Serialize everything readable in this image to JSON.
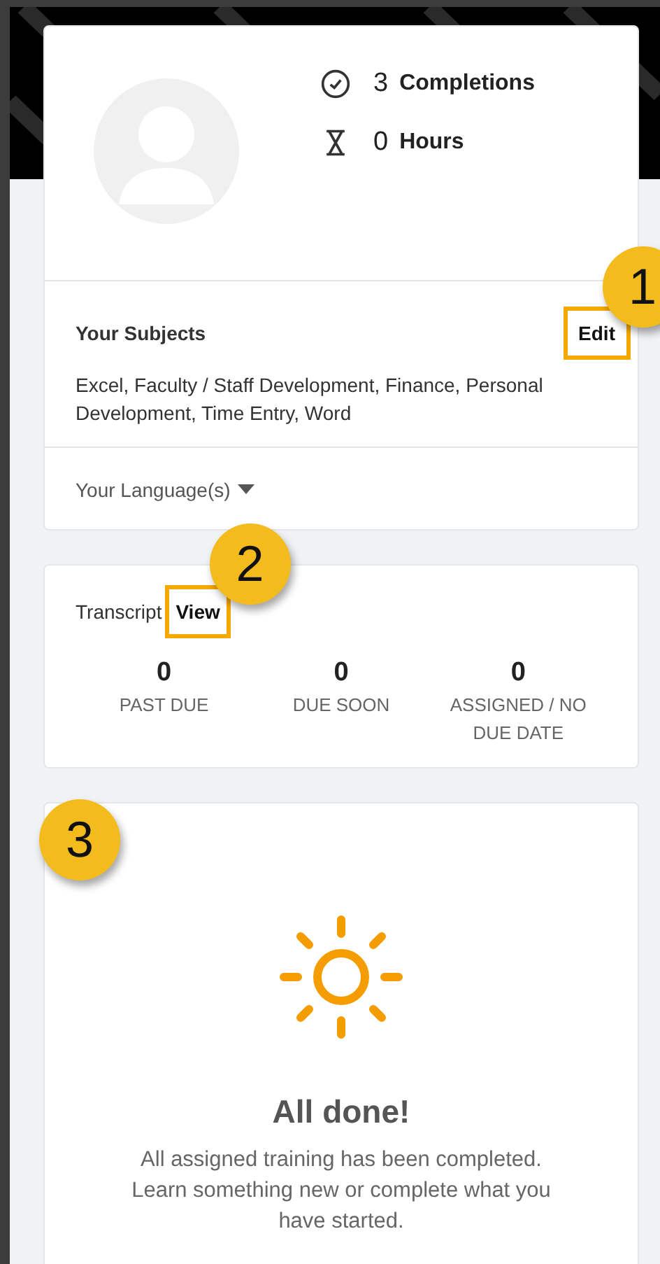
{
  "profile": {
    "stats": [
      {
        "kind": "completions",
        "count": "3",
        "label": "Completions"
      },
      {
        "kind": "hours",
        "count": "0",
        "label": "Hours"
      }
    ],
    "subjects": {
      "title": "Your Subjects",
      "edit_button": {
        "label": "Edit",
        "highlighted": true,
        "callout": "1"
      },
      "list": "Excel, Faculty / Staff Development, Finance, Personal Development, Time Entry, Word"
    },
    "languages": {
      "label": "Your Language(s)",
      "expanded": false
    }
  },
  "transcript": {
    "title": "Transcript",
    "view_button": {
      "label": "View",
      "highlighted": true,
      "callout": "2"
    },
    "counts": [
      {
        "value": "0",
        "label": "PAST DUE"
      },
      {
        "value": "0",
        "label": "DUE SOON"
      },
      {
        "value": "0",
        "label": "ASSIGNED / NO DUE DATE"
      }
    ]
  },
  "all_done": {
    "callout": "3",
    "title": "All done!",
    "message": "All assigned training has been completed. Learn something new or complete what you have started."
  }
}
